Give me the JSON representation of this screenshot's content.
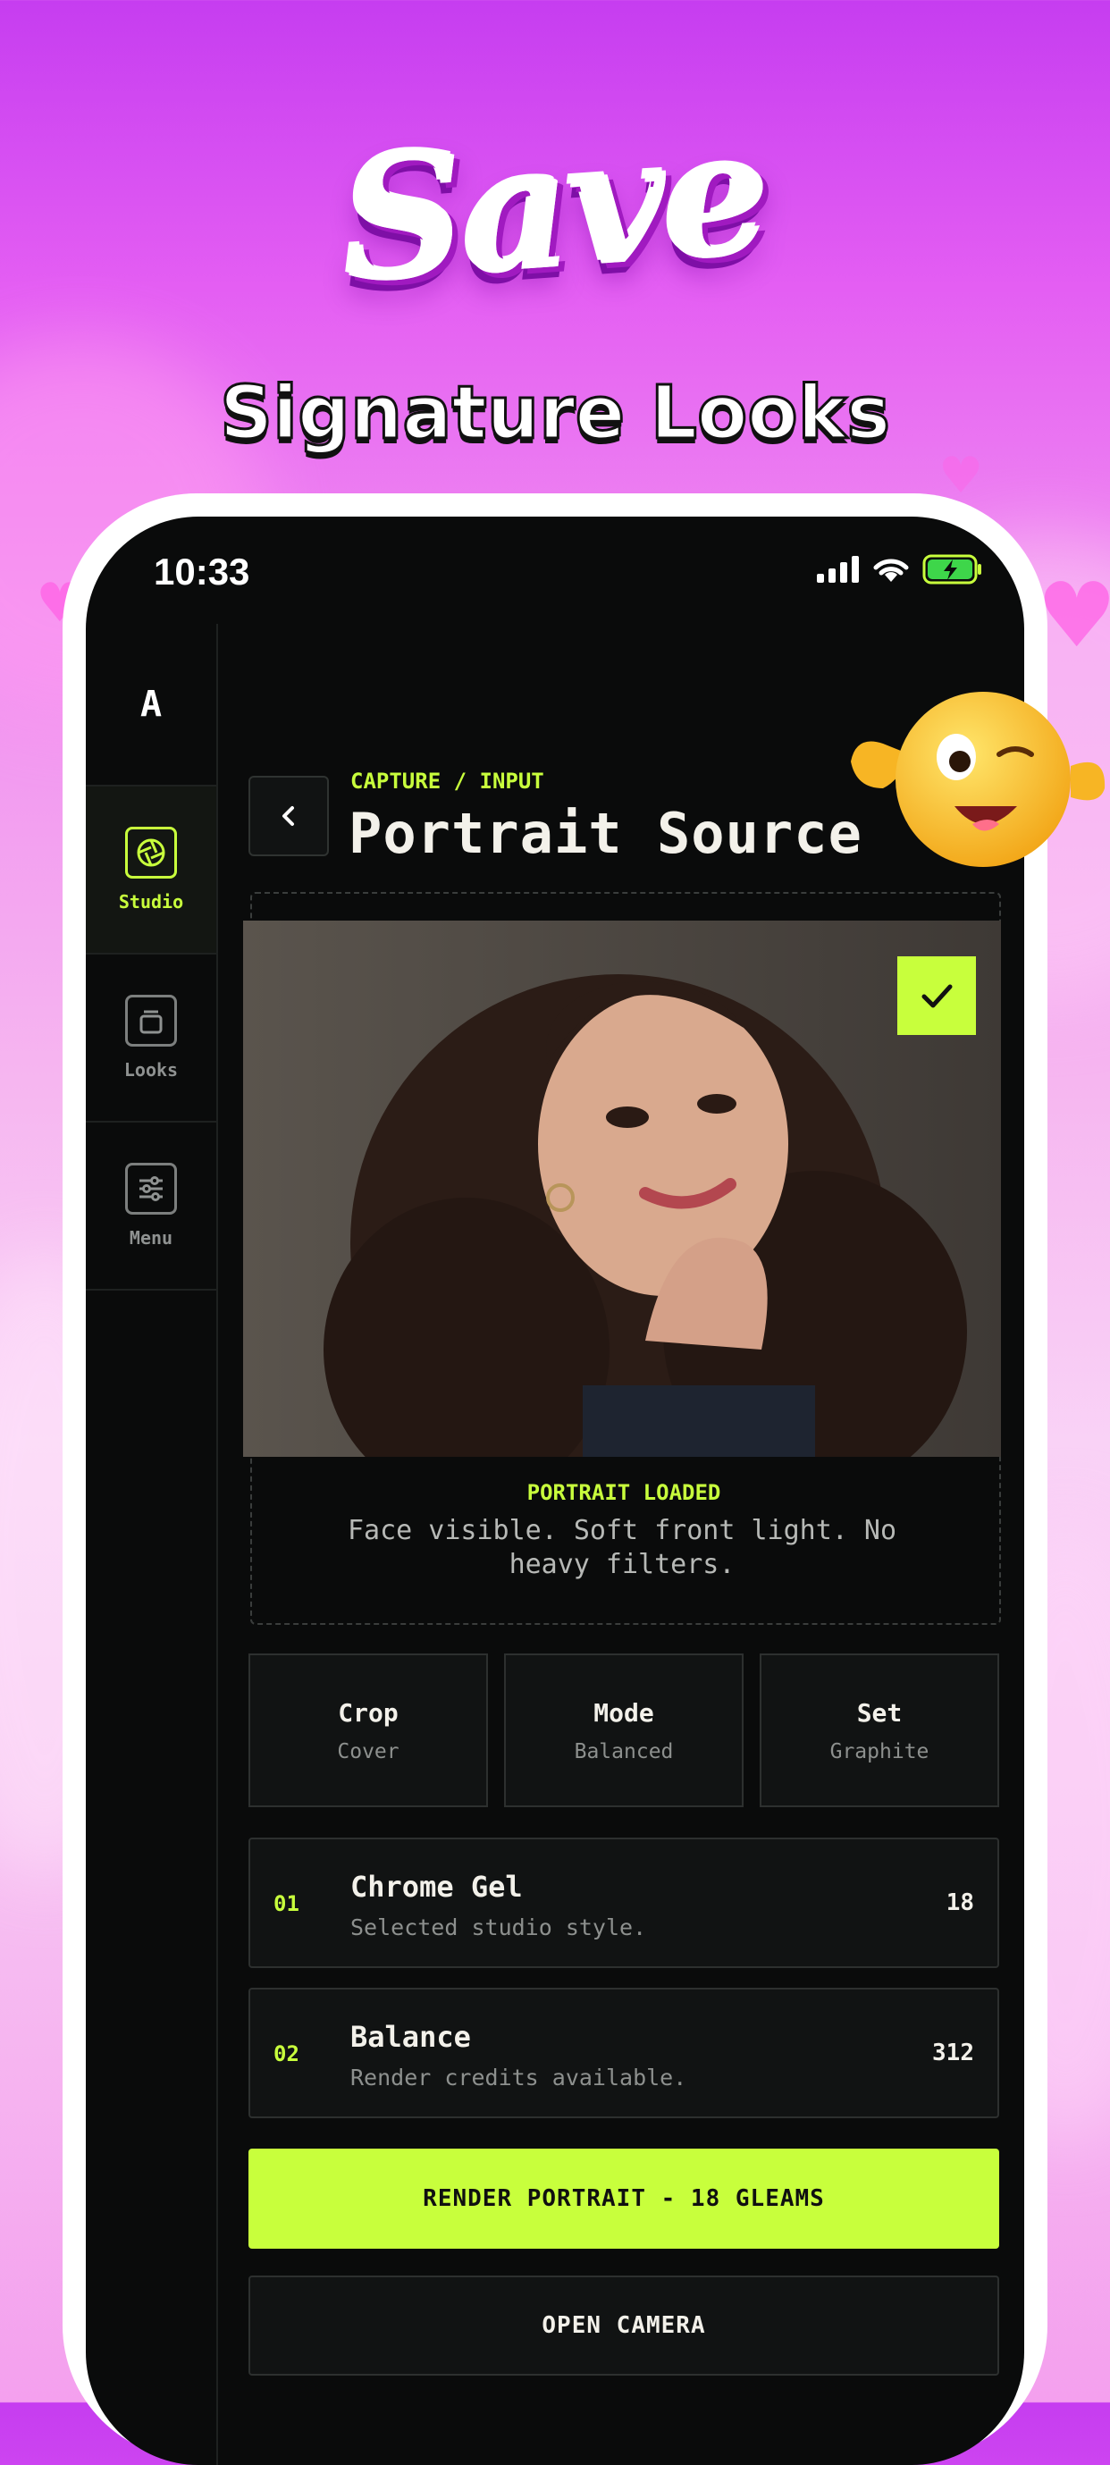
{
  "hero": {
    "title": "Save",
    "subtitle": "Signature Looks"
  },
  "status_bar": {
    "time": "10:33"
  },
  "sidebar": {
    "logo": "A",
    "items": [
      {
        "label": "Studio",
        "icon": "aperture-icon",
        "active": true
      },
      {
        "label": "Looks",
        "icon": "stack-icon",
        "active": false
      },
      {
        "label": "Menu",
        "icon": "sliders-icon",
        "active": false
      }
    ]
  },
  "header": {
    "eyebrow": "CAPTURE / INPUT",
    "title": "Portrait Source"
  },
  "portrait": {
    "status": "PORTRAIT LOADED",
    "hint": "Face visible. Soft front light. No heavy filters."
  },
  "options": [
    {
      "title": "Crop",
      "value": "Cover"
    },
    {
      "title": "Mode",
      "value": "Balanced"
    },
    {
      "title": "Set",
      "value": "Graphite"
    }
  ],
  "info_rows": [
    {
      "number": "01",
      "title": "Chrome Gel",
      "subtitle": "Selected studio style.",
      "value": "18"
    },
    {
      "number": "02",
      "title": "Balance",
      "subtitle": "Render credits available.",
      "value": "312"
    }
  ],
  "actions": {
    "primary": "RENDER PORTRAIT - 18 GLEAMS",
    "secondary": "OPEN CAMERA"
  },
  "colors": {
    "accent": "#c8ff3c",
    "background": "#0a0b0b",
    "panel": "#111313"
  }
}
